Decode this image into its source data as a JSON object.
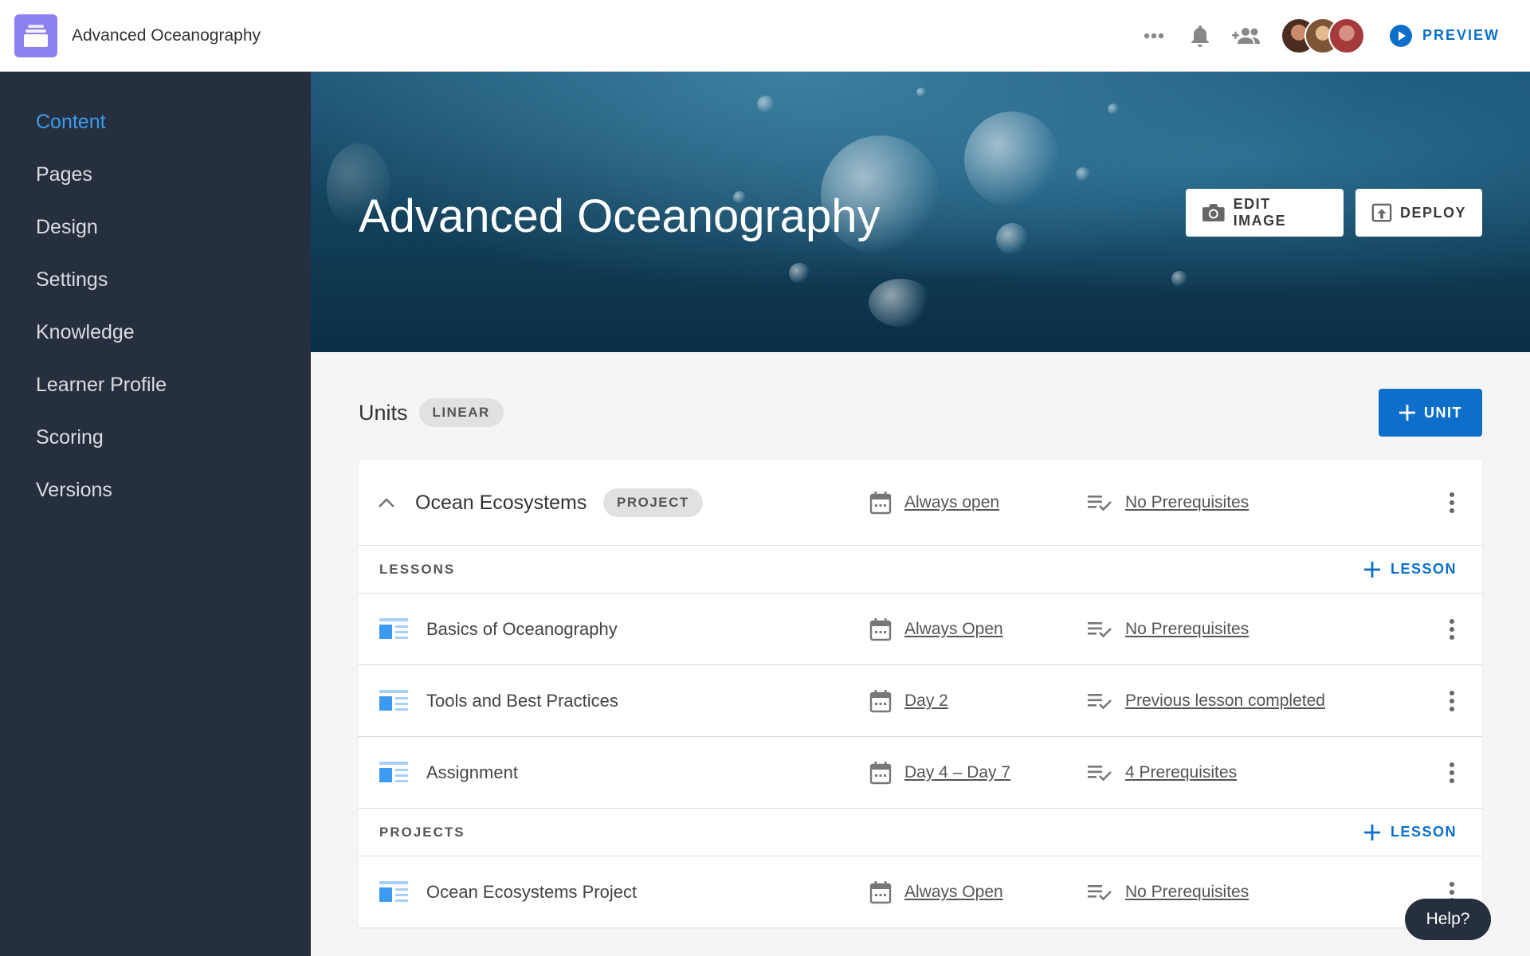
{
  "header": {
    "app_title": "Advanced Oceanography",
    "icons": [
      "more-icon",
      "bell-icon",
      "add-people-icon"
    ],
    "preview_label": "PREVIEW",
    "accent_color": "#0d6fc9"
  },
  "sidebar": {
    "items": [
      {
        "label": "Content",
        "active": true
      },
      {
        "label": "Pages"
      },
      {
        "label": "Design"
      },
      {
        "label": "Settings"
      },
      {
        "label": "Knowledge"
      },
      {
        "label": "Learner Profile"
      },
      {
        "label": "Scoring"
      },
      {
        "label": "Versions"
      }
    ],
    "background": "#262f3d",
    "active_color": "#3c9bf0"
  },
  "hero": {
    "title": "Advanced Oceanography",
    "edit_image_label": "EDIT IMAGE",
    "deploy_label": "DEPLOY"
  },
  "units": {
    "title": "Units",
    "mode_badge": "LINEAR",
    "add_unit_label": "UNIT",
    "list": [
      {
        "name": "Ocean Ecosystems",
        "badge": "PROJECT",
        "availability": "Always open",
        "prerequisites": "No Prerequisites",
        "lessons_section_label": "LESSONS",
        "add_lesson_label": "LESSON",
        "lessons": [
          {
            "name": "Basics of Oceanography",
            "availability": "Always Open",
            "prerequisites": "No Prerequisites"
          },
          {
            "name": "Tools and Best Practices",
            "availability": "Day 2",
            "prerequisites": "Previous lesson completed"
          },
          {
            "name": "Assignment",
            "availability": "Day 4 – Day 7",
            "prerequisites": "4 Prerequisites"
          }
        ],
        "projects_section_label": "PROJECTS",
        "add_project_label": "LESSON",
        "projects": [
          {
            "name": "Ocean Ecosystems Project",
            "availability": "Always Open",
            "prerequisites": "No Prerequisites"
          }
        ]
      }
    ]
  },
  "help_label": "Help?"
}
